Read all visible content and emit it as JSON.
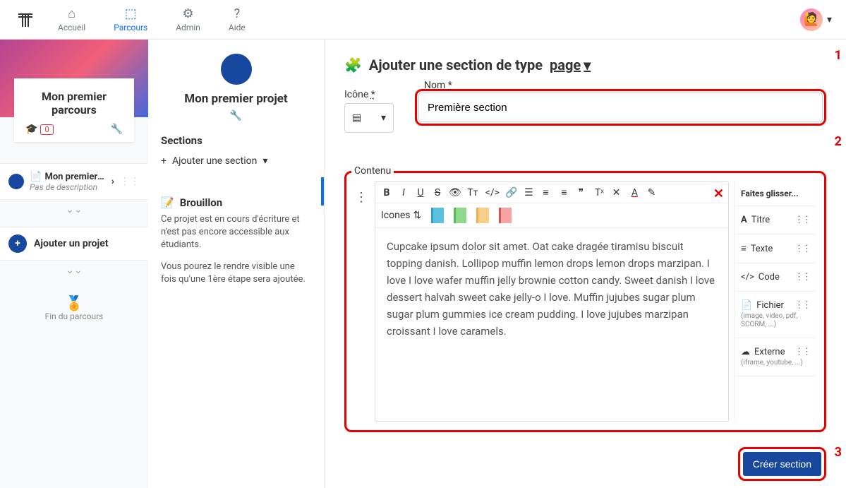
{
  "nav": {
    "accueil": "Accueil",
    "parcours": "Parcours",
    "admin": "Admin",
    "aide": "Aide"
  },
  "col1": {
    "parcours_title": "Mon premier parcours",
    "badge_count": "0",
    "project_name": "Mon premier pro...",
    "project_sub": "Pas de description",
    "add_project": "Ajouter un projet",
    "fin": "Fin du parcours"
  },
  "col2": {
    "title": "Mon premier projet",
    "sections_label": "Sections",
    "add_section": "Ajouter une section",
    "brouillon": "Brouillon",
    "brouillon_text1": "Ce projet est en cours d'écriture et n'est pas encore accessible aux étudiants.",
    "brouillon_text2": "Vous pourez le rendre visible une fois qu'une 1ère étape sera ajoutée."
  },
  "col3": {
    "header_prefix": "Ajouter une section de type",
    "header_type": "page",
    "icon_label": "Icône",
    "name_label": "Nom",
    "required": "*",
    "name_value": "Première section",
    "content_label": "Contenu",
    "icones_label": "Icones",
    "editor_text": "Cupcake ipsum dolor sit amet. Oat cake dragée tiramisu biscuit topping danish. Lollipop muffin lemon drops lemon drops marzipan. I love I love wafer muffin jelly brownie cotton candy. Sweet danish I love dessert halvah sweet cake jelly-o I love. Muffin jujubes sugar plum sugar plum gummies ice cream pudding. I love jujubes marzipan croissant I love caramels.",
    "widgets_header": "Faites glisser...",
    "widgets": {
      "titre": "Titre",
      "texte": "Texte",
      "code": "Code",
      "fichier": "Fichier",
      "fichier_sub": "(image, video, pdf, SCORM, ...)",
      "externe": "Externe",
      "externe_sub": "(iframe, youtube, ...)"
    },
    "create_button": "Créer section"
  },
  "annotations": {
    "one": "1",
    "two": "2",
    "three": "3"
  },
  "colors": {
    "swatches": [
      "#5bc0de",
      "#5cb85c",
      "#f0ad4e",
      "#d9534f"
    ]
  }
}
